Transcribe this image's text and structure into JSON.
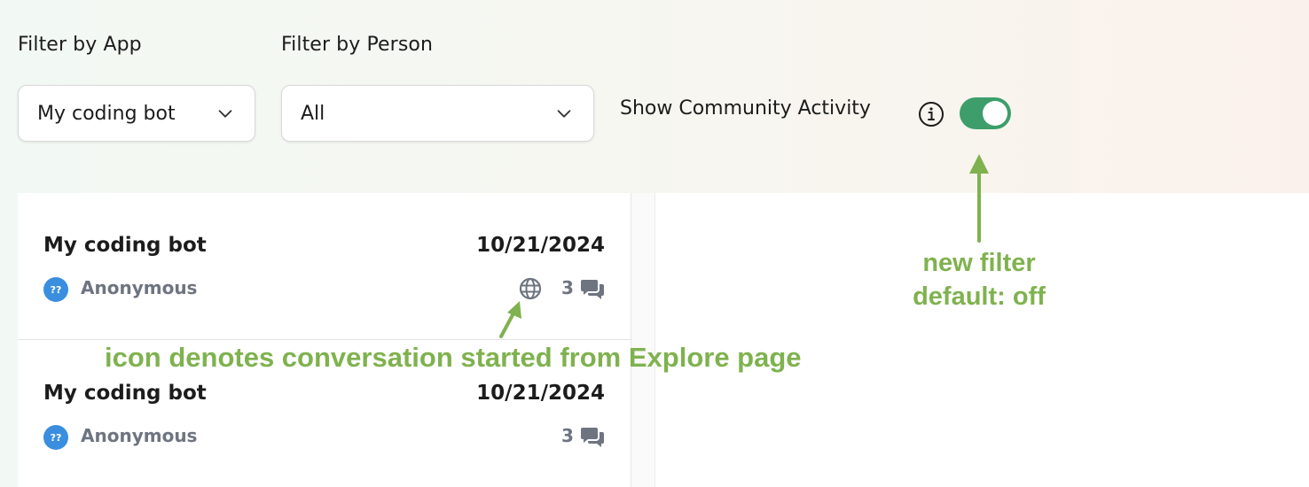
{
  "filters": {
    "app": {
      "label": "Filter by App",
      "value": "My coding bot"
    },
    "person": {
      "label": "Filter by Person",
      "value": "All"
    },
    "community": {
      "label": "Show Community Activity",
      "enabled": true
    }
  },
  "conversations": [
    {
      "title": "My coding bot",
      "date": "10/21/2024",
      "avatar_text": "??",
      "user": "Anonymous",
      "count": "3",
      "from_explore": true
    },
    {
      "title": "My coding bot",
      "date": "10/21/2024",
      "avatar_text": "??",
      "user": "Anonymous",
      "count": "3",
      "from_explore": false
    }
  ],
  "annotations": {
    "icon_note": "icon denotes conversation started from Explore page",
    "filter_note_line1": "new filter",
    "filter_note_line2": "default: off"
  },
  "colors": {
    "toggle_on": "#3d9e6b",
    "annotation": "#7fb24f",
    "avatar": "#3a8ee0"
  },
  "icons": {
    "dropdown": "chevron-down-icon",
    "info": "info-icon",
    "globe": "globe-icon",
    "chat": "chat-bubbles-icon"
  }
}
